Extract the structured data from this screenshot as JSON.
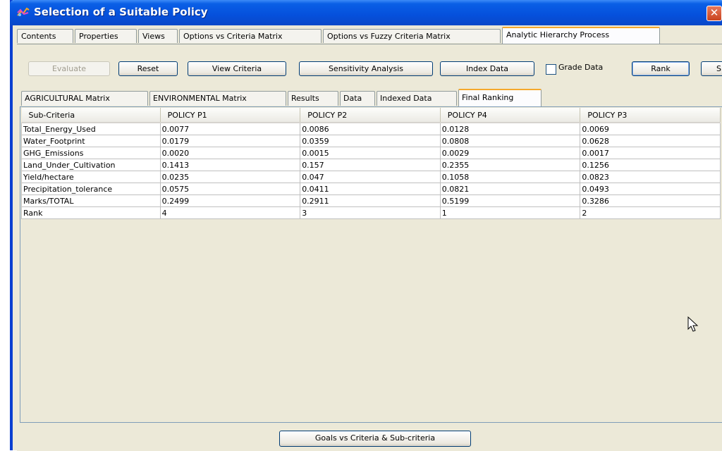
{
  "window": {
    "title": "Selection of  a Suitable Policy",
    "close_glyph": "✕"
  },
  "tabs": [
    {
      "label": "Contents"
    },
    {
      "label": "Properties"
    },
    {
      "label": "Views"
    },
    {
      "label": "Options vs Criteria Matrix"
    },
    {
      "label": "Options vs Fuzzy Criteria Matrix"
    },
    {
      "label": "Analytic Hierarchy Process",
      "active": true
    }
  ],
  "toolbar": {
    "evaluate": "Evaluate",
    "reset": "Reset",
    "view_criteria": "View Criteria",
    "sensitivity": "Sensitivity Analysis",
    "index_data": "Index Data",
    "grade_data": "Grade Data",
    "grade_checked": false,
    "rank": "Rank",
    "s_partial": "S"
  },
  "subtabs": [
    {
      "label": "AGRICULTURAL Matrix"
    },
    {
      "label": "ENVIRONMENTAL Matrix"
    },
    {
      "label": "Results"
    },
    {
      "label": "Data"
    },
    {
      "label": "Indexed Data"
    },
    {
      "label": "Final Ranking",
      "active": true
    }
  ],
  "table": {
    "headers": [
      "Sub-Criteria",
      "POLICY P1",
      "POLICY P2",
      "POLICY P4",
      "POLICY P3"
    ],
    "rows": [
      [
        "Total_Energy_Used",
        "0.0077",
        "0.0086",
        "0.0128",
        "0.0069"
      ],
      [
        "Water_Footprint",
        "0.0179",
        "0.0359",
        "0.0808",
        "0.0628"
      ],
      [
        "GHG_Emissions",
        "0.0020",
        "0.0015",
        "0.0029",
        "0.0017"
      ],
      [
        "Land_Under_Cultivation",
        "0.1413",
        "0.157",
        "0.2355",
        "0.1256"
      ],
      [
        "Yield/hectare",
        "0.0235",
        "0.047",
        "0.1058",
        "0.0823"
      ],
      [
        "Precipitation_tolerance",
        "0.0575",
        "0.0411",
        "0.0821",
        "0.0493"
      ],
      [
        "Marks/TOTAL",
        "0.2499",
        "0.2911",
        "0.5199",
        "0.3286"
      ],
      [
        "Rank",
        "4",
        "3",
        "1",
        "2"
      ]
    ]
  },
  "footer": {
    "goals_button": "Goals vs Criteria & Sub-criteria"
  },
  "icons": {
    "app": "app-logo-icon",
    "cursor": "mouse-pointer-icon",
    "close": "close-icon"
  }
}
